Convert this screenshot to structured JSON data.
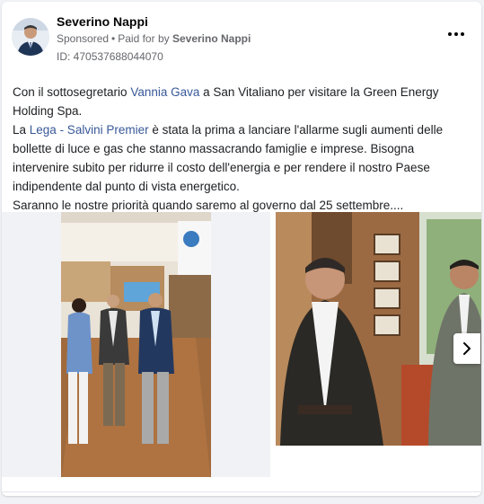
{
  "post": {
    "author": "Severino Nappi",
    "sponsored_label": "Sponsored",
    "separator": "•",
    "paid_for_prefix": "Paid for by",
    "paid_for_name": "Severino Nappi",
    "ad_id": "ID: 470537688044070",
    "more_icon": "more-horizontal-icon"
  },
  "body": {
    "line1_prefix": "Con il sottosegretario ",
    "line1_link": "Vannia Gava",
    "line1_suffix": " a San Vitaliano per visitare la Green Energy Holding Spa.",
    "line2_prefix": "La ",
    "line2_link": "Lega - Salvini Premier",
    "line2_suffix": " è stata la prima a lanciare l'allarme sugli aumenti delle bollette di luce e gas che stanno massacrando famiglie e imprese. Bisogna intervenire subito per ridurre il costo dell'energia e per rendere il nostro Paese indipendente dal punto di vista energetico.",
    "line3": "Saranno le nostre priorità quando saremo al governo dal 25 settembre...."
  },
  "carousel": {
    "next_icon": "chevron-right-icon"
  },
  "colors": {
    "link": "#385898",
    "muted": "#65676b"
  }
}
